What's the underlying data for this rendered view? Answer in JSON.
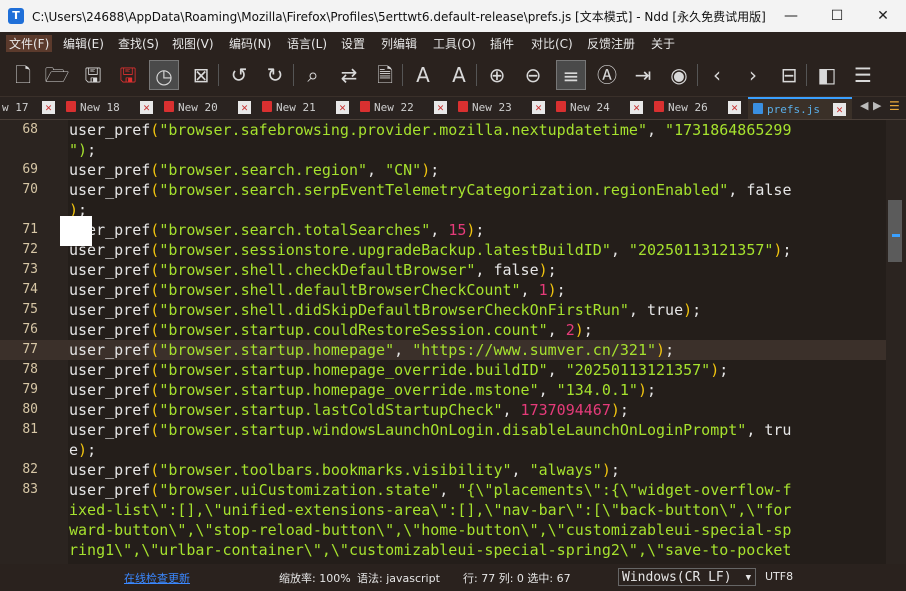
{
  "titlebar": {
    "title": "C:\\Users\\24688\\AppData\\Roaming\\Mozilla\\Firefox\\Profiles\\5erttwt6.default-release\\prefs.js [文本模式] - Ndd [永久免费试用版]",
    "minimize": "—",
    "maximize": "☐",
    "close": "✕"
  },
  "menu": [
    "文件(F)",
    "编辑(E)",
    "查找(S)",
    "视图(V)",
    "编码(N)",
    "语言(L)",
    "设置",
    "列编辑",
    "工具(O)",
    "插件",
    "对比(C)",
    "反馈注册",
    "关于"
  ],
  "tabs": [
    {
      "label": "w 17"
    },
    {
      "label": "New 18"
    },
    {
      "label": "New 20"
    },
    {
      "label": "New 21"
    },
    {
      "label": "New 22"
    },
    {
      "label": "New 23"
    },
    {
      "label": "New 24"
    },
    {
      "label": "New 26"
    },
    {
      "label": "prefs.js"
    }
  ],
  "editor": {
    "lines": [
      {
        "num": "68",
        "parts": [
          [
            "user_pref",
            ""
          ],
          [
            "(",
            "p"
          ],
          [
            "\"browser.safebrowsing.provider.mozilla.nextupdatetime\"",
            "s"
          ],
          [
            ", ",
            ""
          ],
          [
            "\"1731864865299",
            "s"
          ]
        ]
      },
      {
        "num": "",
        "parts": [
          [
            "\")",
            "s"
          ],
          [
            ";",
            ""
          ]
        ]
      },
      {
        "num": "69",
        "parts": [
          [
            "user_pref",
            ""
          ],
          [
            "(",
            "p"
          ],
          [
            "\"browser.search.region\"",
            "s"
          ],
          [
            ", ",
            ""
          ],
          [
            "\"CN\"",
            "s"
          ],
          [
            ")",
            "p"
          ],
          [
            ";",
            ""
          ]
        ]
      },
      {
        "num": "70",
        "parts": [
          [
            "user_pref",
            ""
          ],
          [
            "(",
            "p"
          ],
          [
            "\"browser.search.serpEventTelemetryCategorization.regionEnabled\"",
            "s"
          ],
          [
            ", false",
            ""
          ]
        ]
      },
      {
        "num": "",
        "parts": [
          [
            ")",
            "p"
          ],
          [
            ";",
            ""
          ]
        ]
      },
      {
        "num": "71",
        "parts": [
          [
            "user_pref",
            ""
          ],
          [
            "(",
            "p"
          ],
          [
            "\"browser.search.totalSearches\"",
            "s"
          ],
          [
            ", ",
            ""
          ],
          [
            "15",
            "n"
          ],
          [
            ")",
            "p"
          ],
          [
            ";",
            ""
          ]
        ]
      },
      {
        "num": "72",
        "parts": [
          [
            "user_pref",
            ""
          ],
          [
            "(",
            "p"
          ],
          [
            "\"browser.sessionstore.upgradeBackup.latestBuildID\"",
            "s"
          ],
          [
            ", ",
            ""
          ],
          [
            "\"20250113121357\"",
            "s"
          ],
          [
            ")",
            "p"
          ],
          [
            ";",
            ""
          ]
        ]
      },
      {
        "num": "73",
        "parts": [
          [
            "user_pref",
            ""
          ],
          [
            "(",
            "p"
          ],
          [
            "\"browser.shell.checkDefaultBrowser\"",
            "s"
          ],
          [
            ", false",
            ""
          ],
          [
            ")",
            "p"
          ],
          [
            ";",
            ""
          ]
        ]
      },
      {
        "num": "74",
        "parts": [
          [
            "user_pref",
            ""
          ],
          [
            "(",
            "p"
          ],
          [
            "\"browser.shell.defaultBrowserCheckCount\"",
            "s"
          ],
          [
            ", ",
            ""
          ],
          [
            "1",
            "n"
          ],
          [
            ")",
            "p"
          ],
          [
            ";",
            ""
          ]
        ]
      },
      {
        "num": "75",
        "parts": [
          [
            "user_pref",
            ""
          ],
          [
            "(",
            "p"
          ],
          [
            "\"browser.shell.didSkipDefaultBrowserCheckOnFirstRun\"",
            "s"
          ],
          [
            ", true",
            ""
          ],
          [
            ")",
            "p"
          ],
          [
            ";",
            ""
          ]
        ]
      },
      {
        "num": "76",
        "parts": [
          [
            "user_pref",
            ""
          ],
          [
            "(",
            "p"
          ],
          [
            "\"browser.startup.couldRestoreSession.count\"",
            "s"
          ],
          [
            ", ",
            ""
          ],
          [
            "2",
            "n"
          ],
          [
            ")",
            "p"
          ],
          [
            ";",
            ""
          ]
        ]
      },
      {
        "num": "77",
        "hl": true,
        "parts": [
          [
            "user_pref",
            ""
          ],
          [
            "(",
            "p"
          ],
          [
            "\"browser.startup.homepage\"",
            "s"
          ],
          [
            ", ",
            ""
          ],
          [
            "\"https://www.sumver.cn/321\"",
            "s"
          ],
          [
            ")",
            "p"
          ],
          [
            ";",
            ""
          ]
        ]
      },
      {
        "num": "78",
        "parts": [
          [
            "user_pref",
            ""
          ],
          [
            "(",
            "p"
          ],
          [
            "\"browser.startup.homepage_override.buildID\"",
            "s"
          ],
          [
            ", ",
            ""
          ],
          [
            "\"20250113121357\"",
            "s"
          ],
          [
            ")",
            "p"
          ],
          [
            ";",
            ""
          ]
        ]
      },
      {
        "num": "79",
        "parts": [
          [
            "user_pref",
            ""
          ],
          [
            "(",
            "p"
          ],
          [
            "\"browser.startup.homepage_override.mstone\"",
            "s"
          ],
          [
            ", ",
            ""
          ],
          [
            "\"134.0.1\"",
            "s"
          ],
          [
            ")",
            "p"
          ],
          [
            ";",
            ""
          ]
        ]
      },
      {
        "num": "80",
        "parts": [
          [
            "user_pref",
            ""
          ],
          [
            "(",
            "p"
          ],
          [
            "\"browser.startup.lastColdStartupCheck\"",
            "s"
          ],
          [
            ", ",
            ""
          ],
          [
            "1737094467",
            "n"
          ],
          [
            ")",
            "p"
          ],
          [
            ";",
            ""
          ]
        ]
      },
      {
        "num": "81",
        "parts": [
          [
            "user_pref",
            ""
          ],
          [
            "(",
            "p"
          ],
          [
            "\"browser.startup.windowsLaunchOnLogin.disableLaunchOnLoginPrompt\"",
            "s"
          ],
          [
            ", tru",
            ""
          ]
        ]
      },
      {
        "num": "",
        "parts": [
          [
            "e",
            ""
          ],
          [
            ")",
            "p"
          ],
          [
            ";",
            ""
          ]
        ]
      },
      {
        "num": "82",
        "parts": [
          [
            "user_pref",
            ""
          ],
          [
            "(",
            "p"
          ],
          [
            "\"browser.toolbars.bookmarks.visibility\"",
            "s"
          ],
          [
            ", ",
            ""
          ],
          [
            "\"always\"",
            "s"
          ],
          [
            ")",
            "p"
          ],
          [
            ";",
            ""
          ]
        ]
      },
      {
        "num": "83",
        "parts": [
          [
            "user_pref",
            ""
          ],
          [
            "(",
            "p"
          ],
          [
            "\"browser.uiCustomization.state\"",
            "s"
          ],
          [
            ", ",
            ""
          ],
          [
            "\"{\\\"placements\\\":{\\\"widget-overflow-f",
            "s"
          ]
        ]
      },
      {
        "num": "",
        "parts": [
          [
            "ixed-list\\\":[],\\\"unified-extensions-area\\\":[],\\\"nav-bar\\\":[\\\"back-button\\\",\\\"for",
            "s"
          ]
        ]
      },
      {
        "num": "",
        "parts": [
          [
            "ward-button\\\",\\\"stop-reload-button\\\",\\\"home-button\\\",\\\"customizableui-special-sp",
            "s"
          ]
        ]
      },
      {
        "num": "",
        "parts": [
          [
            "ring1\\\",\\\"urlbar-container\\\",\\\"customizableui-special-spring2\\\",\\\"save-to-pocket",
            "s"
          ]
        ]
      }
    ]
  },
  "status": {
    "link": "在线检查更新",
    "zoom": "缩放率: 100%",
    "lang": "语法: javascript",
    "pos": "行: 77 列: 0 选中: 67",
    "eol": "Windows(CR LF)",
    "encoding": "UTF8"
  },
  "colors": {
    "accent": "#3aa0ff",
    "string": "#a6e22e",
    "number": "#e63b7a",
    "paren": "#f1c40f"
  }
}
